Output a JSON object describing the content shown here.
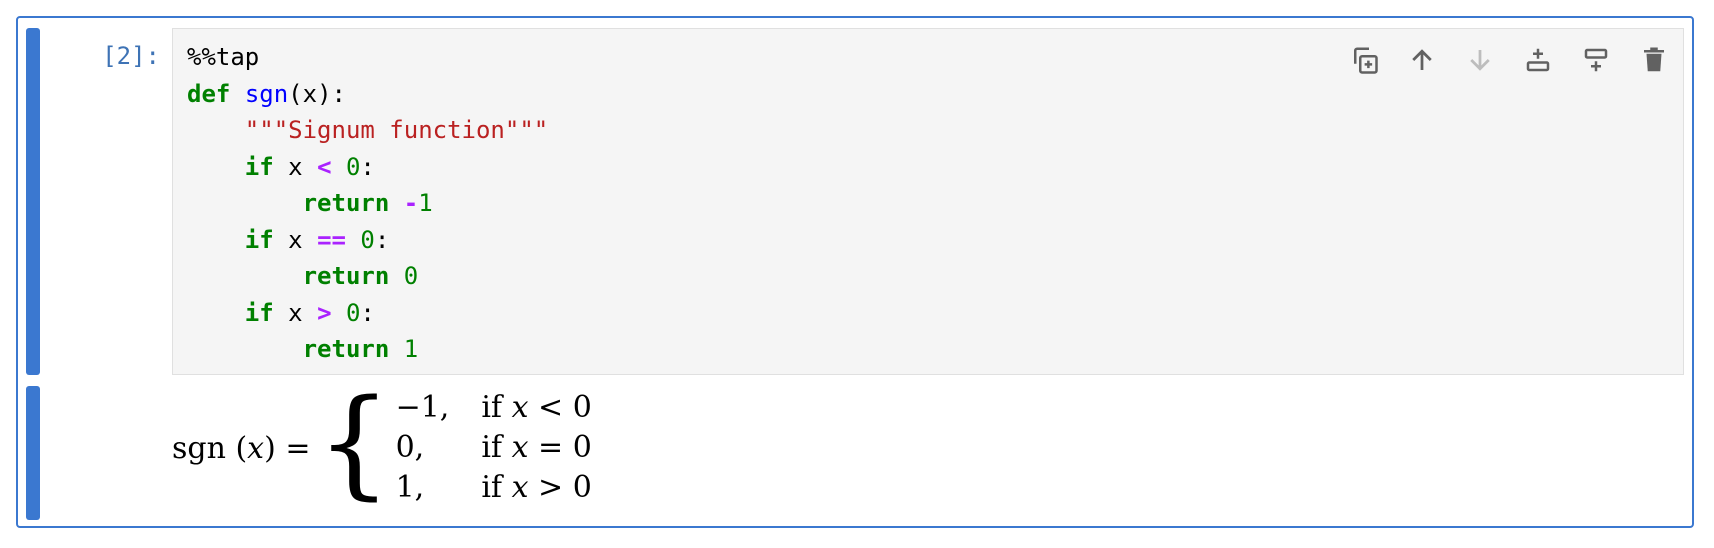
{
  "cell": {
    "prompt": "[2]:",
    "code_lines": [
      [
        {
          "t": "%%tap",
          "c": ""
        }
      ],
      [
        {
          "t": "def",
          "c": "kw"
        },
        {
          "t": " ",
          "c": ""
        },
        {
          "t": "sgn",
          "c": "fn"
        },
        {
          "t": "(x):",
          "c": ""
        }
      ],
      [
        {
          "t": "    ",
          "c": ""
        },
        {
          "t": "\"\"\"Signum function\"\"\"",
          "c": "st"
        }
      ],
      [
        {
          "t": "    ",
          "c": ""
        },
        {
          "t": "if",
          "c": "kw"
        },
        {
          "t": " x ",
          "c": ""
        },
        {
          "t": "<",
          "c": "op"
        },
        {
          "t": " ",
          "c": ""
        },
        {
          "t": "0",
          "c": "nm"
        },
        {
          "t": ":",
          "c": ""
        }
      ],
      [
        {
          "t": "        ",
          "c": ""
        },
        {
          "t": "return",
          "c": "kw"
        },
        {
          "t": " ",
          "c": ""
        },
        {
          "t": "-",
          "c": "op"
        },
        {
          "t": "1",
          "c": "nm"
        }
      ],
      [
        {
          "t": "    ",
          "c": ""
        },
        {
          "t": "if",
          "c": "kw"
        },
        {
          "t": " x ",
          "c": ""
        },
        {
          "t": "==",
          "c": "op"
        },
        {
          "t": " ",
          "c": ""
        },
        {
          "t": "0",
          "c": "nm"
        },
        {
          "t": ":",
          "c": ""
        }
      ],
      [
        {
          "t": "        ",
          "c": ""
        },
        {
          "t": "return",
          "c": "kw"
        },
        {
          "t": " ",
          "c": ""
        },
        {
          "t": "0",
          "c": "nm"
        }
      ],
      [
        {
          "t": "    ",
          "c": ""
        },
        {
          "t": "if",
          "c": "kw"
        },
        {
          "t": " x ",
          "c": ""
        },
        {
          "t": ">",
          "c": "op"
        },
        {
          "t": " ",
          "c": ""
        },
        {
          "t": "0",
          "c": "nm"
        },
        {
          "t": ":",
          "c": ""
        }
      ],
      [
        {
          "t": "        ",
          "c": ""
        },
        {
          "t": "return",
          "c": "kw"
        },
        {
          "t": " ",
          "c": ""
        },
        {
          "t": "1",
          "c": "nm"
        }
      ]
    ],
    "toolbar": [
      {
        "name": "duplicate-cell-icon",
        "enabled": true
      },
      {
        "name": "move-up-icon",
        "enabled": true
      },
      {
        "name": "move-down-icon",
        "enabled": false
      },
      {
        "name": "insert-above-icon",
        "enabled": true
      },
      {
        "name": "insert-below-icon",
        "enabled": true
      },
      {
        "name": "delete-icon",
        "enabled": true
      }
    ]
  },
  "output": {
    "lhs_fn": "sgn",
    "lhs_open": " (",
    "lhs_var": "x",
    "lhs_close": ") =",
    "brace": "{",
    "cases": [
      {
        "value": "−1,",
        "cond_prefix": "if ",
        "cond_var": "x",
        "cond_rest": " < 0"
      },
      {
        "value": "0,",
        "cond_prefix": "if ",
        "cond_var": "x",
        "cond_rest": " = 0"
      },
      {
        "value": "1,",
        "cond_prefix": "if ",
        "cond_var": "x",
        "cond_rest": " > 0"
      }
    ]
  },
  "colors": {
    "accent": "#3b78d0",
    "keyword": "#008000",
    "function": "#0000ff",
    "string": "#ba2121",
    "operator": "#aa22ff",
    "number": "#008000",
    "icon_enabled": "#616161",
    "icon_disabled": "#bdbdbd"
  }
}
